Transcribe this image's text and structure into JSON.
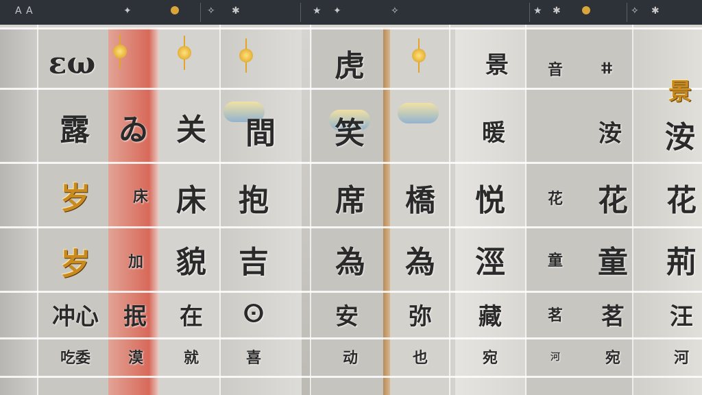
{
  "topbar": {
    "left_label": "A",
    "glyphs": [
      "✦",
      "✧",
      "✱",
      "★"
    ]
  },
  "grid": {
    "row1": [
      "εω",
      "景",
      "音",
      "虎",
      "ⵌ"
    ],
    "row2": [
      "露",
      "ゐ",
      "关",
      "間",
      "笑",
      "暖",
      "洝"
    ],
    "row3": [
      "岁",
      "床",
      "抱",
      "席",
      "橋",
      "悦",
      "花"
    ],
    "row4": [
      "岁",
      "加",
      "貌",
      "吉",
      "為",
      "涇",
      "童",
      "荊"
    ],
    "row5": [
      "冲心",
      "抿",
      "在",
      "ⵙ",
      "安",
      "弥",
      "藏",
      "茗",
      "汪"
    ],
    "row6": [
      "吃委",
      "漠",
      "就",
      "喜",
      "动",
      "也",
      "宛",
      "河"
    ]
  },
  "colors": {
    "topbar": "#2d3138",
    "accent_red": "#d8695a",
    "sun": "#d99a1c"
  }
}
